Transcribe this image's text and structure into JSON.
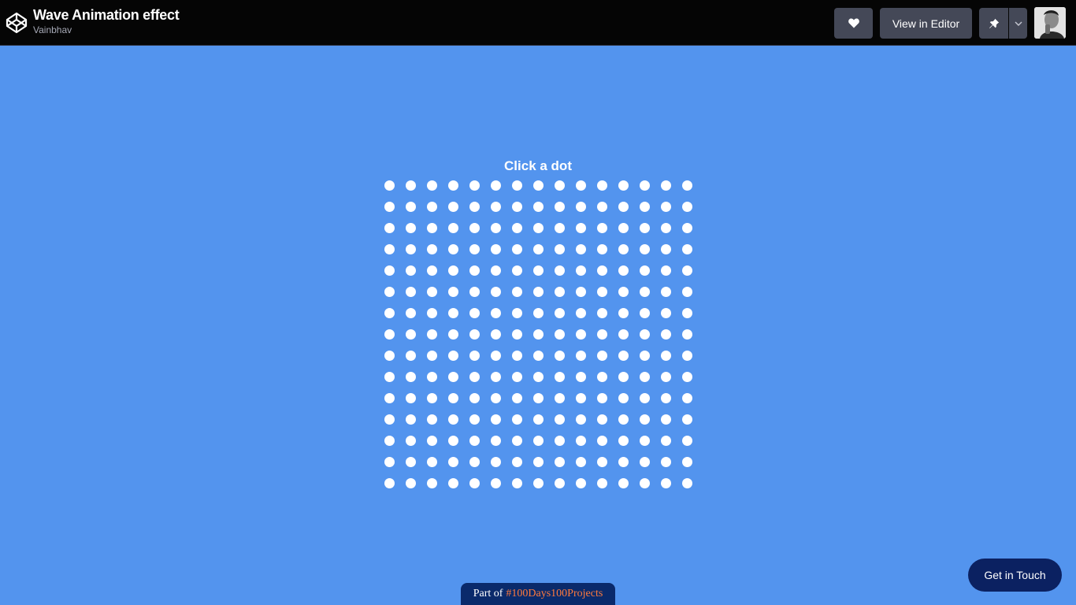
{
  "header": {
    "title": "Wave Animation effect",
    "author": "Vainbhav",
    "editor_label": "View in Editor",
    "icons": [
      "codepen-logo-icon",
      "heart-icon",
      "pin-icon",
      "chevron-down-icon"
    ]
  },
  "main": {
    "prompt": "Click a dot",
    "grid": {
      "rows": 15,
      "columns": 15
    },
    "dot_color": "#FFFFFF"
  },
  "footer": {
    "prefix": "Part of",
    "tag": "#100Days100Projects"
  },
  "contact": {
    "label": "Get in Touch"
  },
  "colors": {
    "background": "#5394EE",
    "topbar": "#050505",
    "button": "#444857",
    "footer_badge": "#0A2A6B",
    "footer_tag": "#FF7A3D",
    "contact_button": "#0B2161"
  }
}
